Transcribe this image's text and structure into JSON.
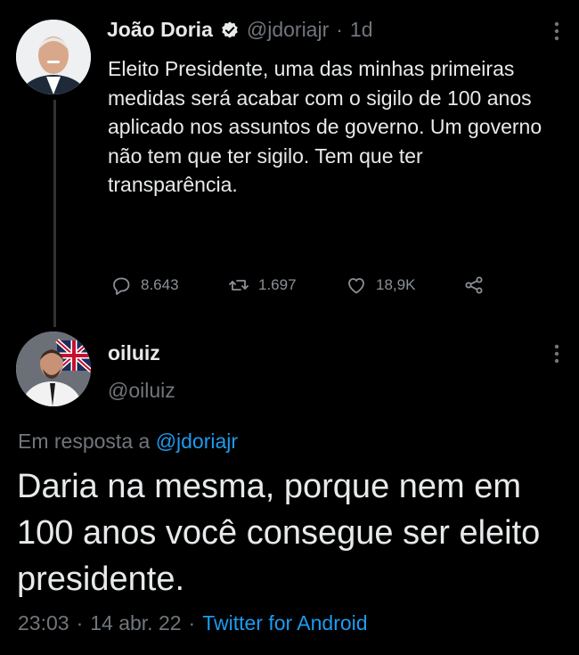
{
  "tweet": {
    "author_name": "João Doria",
    "author_handle": "@jdoriajr",
    "separator": "·",
    "age": "1d",
    "text": "Eleito Presidente, uma das minhas primeiras medidas será acabar com o sigilo de 100 anos aplicado nos assuntos de governo. Um governo não tem que ter sigilo. Tem que ter transparência.",
    "metrics": {
      "replies": "8.643",
      "retweets": "1.697",
      "likes": "18,9K"
    }
  },
  "reply": {
    "author_name": "oiluiz",
    "author_handle": "@oiluiz",
    "in_reply_prefix": "Em resposta a",
    "in_reply_handle": "@jdoriajr",
    "text": "Daria na mesma, porque nem em 100 anos você consegue ser eleito presidente.",
    "time": "23:03",
    "date": "14 abr. 22",
    "separator": "·",
    "source": "Twitter for Android"
  },
  "icons": {
    "more": "more-vertical-icon",
    "verified": "verified-badge-icon",
    "reply": "reply-icon",
    "retweet": "retweet-icon",
    "like": "heart-icon",
    "share": "share-icon"
  },
  "colors": {
    "background": "#000000",
    "text": "#e7e9ea",
    "muted": "#71767b",
    "link": "#1d9bf0"
  }
}
